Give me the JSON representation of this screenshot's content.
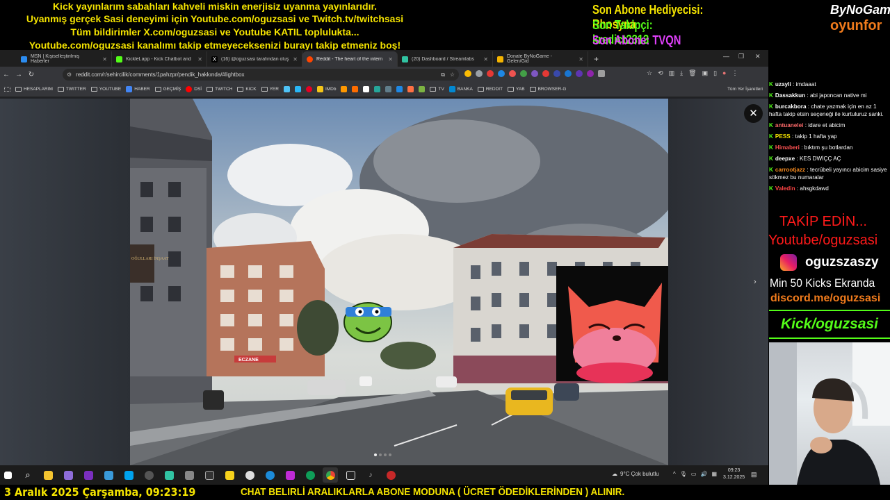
{
  "overlay": {
    "lines": [
      "Kick yayınlarım sabahları kahveli miskin enerjisiz uyanma yayınlarıdır.",
      "Uyanmış gerçek Sasi deneyimi için Youtube.com/oguzsasi ve Twitch.tv/twitchsasi",
      "Tüm bildirimler X.com/oguzsasi ve Youtube KATIL toplulukta...",
      "Youtube.com/oguzsasi kanalımı takip etmeyeceksenizi burayı takip etmeniz boş!"
    ],
    "sub_gift": "Son Abone Hediyecisi: Rhosyna",
    "last_follower": "Son Takipçi: kredict2313",
    "last_sub": "Son Abone: TVQN",
    "brand_top": "ByNoGame",
    "brand_bottom": "oyunfor"
  },
  "browser": {
    "tabs": [
      {
        "title": "MSN | Kişiselleştirilmiş Haberler",
        "color": "#2c8cf0"
      },
      {
        "title": "KickleLapp - Kick Chatbot and",
        "color": "#53fc18"
      },
      {
        "title": "(16) @oguzsasi tarafından oluş",
        "color": "#ffffff"
      },
      {
        "title": "Reddit - The heart of the intern",
        "color": "#ff4500"
      },
      {
        "title": "(20) Dashboard / Streamlabs",
        "color": "#31c3a2"
      },
      {
        "title": "Donate ByNoGame - Gelen/Gid",
        "color": "#f5b400"
      }
    ],
    "url": "reddit.com/r/sehircilik/comments/1pahzpr/pendik_hakkında/#lightbox",
    "bookmarks": [
      "HESAPLARIM",
      "TWITTER",
      "YOUTUBE",
      "HABER",
      "GEÇMİŞ",
      "DSİ",
      "TWITCH",
      "KICK",
      "YER",
      "IMDb",
      "TV",
      "BANKA",
      "REDDIT",
      "YAB",
      "BROWSER-G"
    ],
    "all_bookmarks": "Tüm Yer İşaretleri"
  },
  "photo": {
    "shop_sign": "ECZANE",
    "left_sign": "OĞULLARI İNŞAAT"
  },
  "taskbar": {
    "weather": "9°C  Çok bulutlu",
    "time": "09:23",
    "date": "3.12.2025"
  },
  "bottom": {
    "date_text": "3 Aralık 2025 Çarşamba, 09:23:19",
    "ticker": "CHAT BELIRLİ ARALIKLARLA ABONE MODUNA ( ÜCRET ÖDEDİKLERİNDEN ) ALINIR."
  },
  "chat": [
    {
      "user": "uzayli",
      "color": "#ffffff",
      "text": "imdaaat"
    },
    {
      "user": "Dassakkun",
      "color": "#ffffff",
      "text": "abi japoncan native mi"
    },
    {
      "user": "burcakbora",
      "color": "#ffffff",
      "text": "chate yazmak için en az 1 hafta takip etsin seçeneği ile kurtuluruz sanki."
    },
    {
      "user": "antuanelei",
      "color": "#ff6b6b",
      "text": "idare et abicim"
    },
    {
      "user": "PESS",
      "color": "#f5e400",
      "text": "takip 1 hafta yap"
    },
    {
      "user": "Himaberi",
      "color": "#ff5252",
      "text": "bıktım şu botlardan"
    },
    {
      "user": "deepxe",
      "color": "#ffffff",
      "text": "KES DWİÇÇ AÇ"
    },
    {
      "user": "carrootjazz",
      "color": "#f58a1f",
      "text": "tecrübeli yayıncı abicim sasiye sökmez bu numaralar"
    },
    {
      "user": "Valedin",
      "color": "#ff4444",
      "text": "ahsgkdawd"
    }
  ],
  "promo": {
    "follow": "TAKİP EDİN...",
    "youtube": "Youtube/oguzsasi",
    "instagram": "oguzszaszy",
    "min_kicks": "Min 50 Kicks Ekranda",
    "discord": "discord.me/oguzsasi",
    "kick": "Kick/oguzsasi"
  }
}
